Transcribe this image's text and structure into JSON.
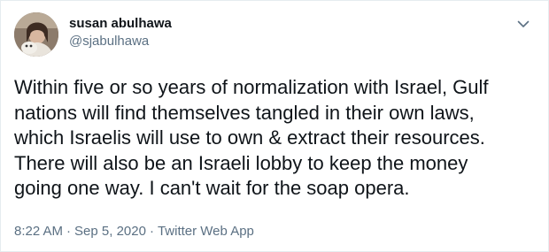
{
  "author": {
    "display_name": "susan abulhawa",
    "handle": "@sjabulhawa"
  },
  "tweet": {
    "lines": [
      "Within five or so years of normalization with Israel, Gulf",
      "nations will find themselves tangled in their own laws,",
      "which Israelis will use to own & extract their resources.",
      "There will also be an Israeli lobby to keep the money",
      "going one way. I can't wait for the soap opera."
    ],
    "time": "8:22 AM",
    "separator": "·",
    "date": "Sep 5, 2020",
    "source": "Twitter Web App"
  },
  "icons": {
    "menu": "chevron-down-icon",
    "avatar": "profile-photo"
  },
  "colors": {
    "text": "#0f1419",
    "secondary": "#5b7083",
    "border": "#e6ecf0"
  }
}
